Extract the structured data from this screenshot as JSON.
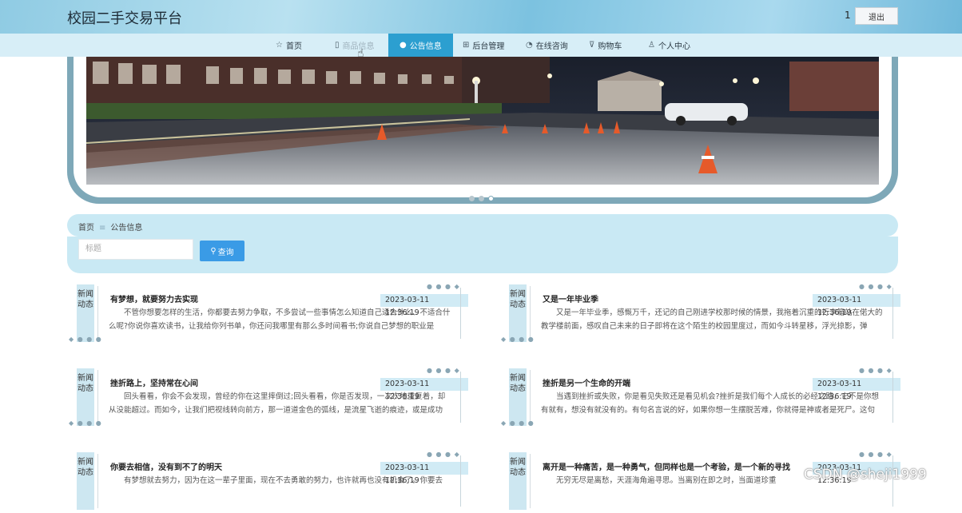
{
  "header": {
    "site_title": "校园二手交易平台",
    "user_count": "1",
    "logout_label": "退出"
  },
  "nav": {
    "items": [
      {
        "label": "首页",
        "icon": "star-icon",
        "state": "normal"
      },
      {
        "label": "商品信息",
        "icon": "doc-icon",
        "state": "faded"
      },
      {
        "label": "公告信息",
        "icon": "dot-icon",
        "state": "active"
      },
      {
        "label": "后台管理",
        "icon": "admin-icon",
        "state": "normal"
      },
      {
        "label": "在线咨询",
        "icon": "chat-icon",
        "state": "normal"
      },
      {
        "label": "购物车",
        "icon": "cart-icon",
        "state": "normal"
      },
      {
        "label": "个人中心",
        "icon": "user-icon",
        "state": "normal"
      }
    ]
  },
  "banner": {
    "active_slide_index": 2,
    "slide_count": 3
  },
  "breadcrumb": {
    "home": "首页",
    "separator": "≡",
    "current": "公告信息"
  },
  "search": {
    "placeholder": "标题",
    "button_label": "查询"
  },
  "cards": [
    {
      "tag": "新闻动态",
      "title": "有梦想，就要努力去实现",
      "date": "2023-03-11 12:36:19",
      "body": "不管你想要怎样的生活，你都要去努力争取，不多尝试一些事情怎么知道自己适合什么、不适合什么呢?你说你喜欢读书，让我给你列书单，你还问我哪里有那么多时间看书;你说自己梦想的职业是"
    },
    {
      "tag": "新闻动态",
      "title": "又是一年毕业季",
      "date": "2023-03-11 12:36:19",
      "body": "又是一年毕业季，感慨万千，还记的自己刚进学校那时候的情景，我拖着沉重的行李箱站在偌大的教学楼前面，感叹自己未来的日子即将在这个陌生的校园里度过，而如今斗转星移，浮光掠影，弹"
    },
    {
      "tag": "新闻动态",
      "title": "挫折路上，坚持常在心间",
      "date": "2023-03-11 12:36:19",
      "body": "回头看看，你会不会发现，曾经的你在这里摔倒过;回头看看，你是否发现，一次次地重复着，却从没能超过。而如今，让我们把视线转向前方，那一道道金色的弧线，是流星飞逝的痕迹，或是成功"
    },
    {
      "tag": "新闻动态",
      "title": "挫折是另一个生命的开端",
      "date": "2023-03-11 12:36:19",
      "body": "当遇到挫折或失败，你是看见失败还是看见机会?挫折是我们每个人成长的必经之路，它不是你想有就有，想没有就没有的。有句名言说的好，如果你想一生摆脱苦难，你就得是神或者是死尸。这句"
    },
    {
      "tag": "新闻动态",
      "title": "你要去相信，没有到不了的明天",
      "date": "2023-03-11 12:36:19",
      "body": "有梦想就去努力，因为在这一辈子里面，现在不去勇敢的努力，也许就再也没有机会了。你要去"
    },
    {
      "tag": "新闻动态",
      "title": "离开是一种痛苦，是一种勇气，但同样也是一个考验，是一个新的寻找",
      "date": "2023-03-11 12:36:19",
      "body": "无穷无尽是离愁，天涯海角遍寻思。当离别在即之时，当面道珍重"
    }
  ],
  "watermark": "CSDN @sheji1999"
}
